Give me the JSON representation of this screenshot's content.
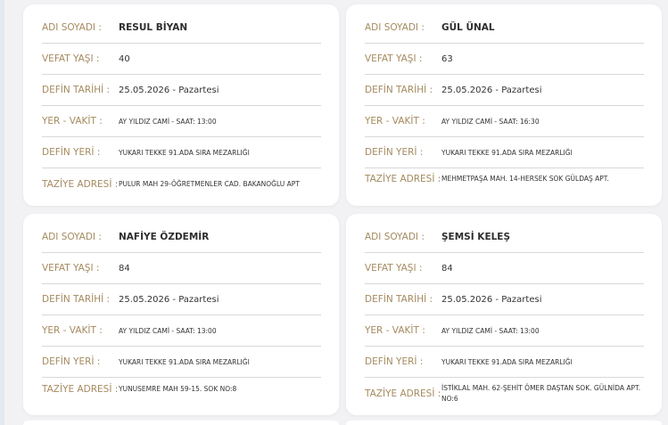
{
  "labels": {
    "name": "ADI SOYADI :",
    "age": "VEFAT YAŞI :",
    "burial_date": "DEFİN TARİHİ :",
    "place_time": "YER - VAKİT :",
    "burial_place": "DEFİN YERİ :",
    "condolence_address": "TAZİYE ADRESİ :"
  },
  "cards": [
    {
      "name": "RESUL BİYAN",
      "age": "40",
      "burial_date": "25.05.2026 - Pazartesi",
      "place_time": "AY YILDIZ CAMİ - SAAT: 13:00",
      "burial_place": "YUKARI TEKKE 91.ADA SIRA MEZARLIĞI",
      "condolence_address": "PULUR MAH 29-ÖĞRETMENLER CAD. BAKANOĞLU APT"
    },
    {
      "name": "GÜL ÜNAL",
      "age": "63",
      "burial_date": "25.05.2026 - Pazartesi",
      "place_time": "AY YILDIZ CAMİ - SAAT: 16:30",
      "burial_place": "YUKARI TEKKE 91.ADA SIRA MEZARLIĞI",
      "condolence_address": "MEHMETPAŞA MAH. 14-HERSEK SOK GÜLDAŞ APT."
    },
    {
      "name": "NAFİYE ÖZDEMİR",
      "age": "84",
      "burial_date": "25.05.2026 - Pazartesi",
      "place_time": "AY YILDIZ CAMİ - SAAT: 13:00",
      "burial_place": "YUKARI TEKKE 91.ADA SIRA MEZARLIĞI",
      "condolence_address": "YUNUSEMRE MAH 59-15. SOK NO:8"
    },
    {
      "name": "ŞEMSİ KELEŞ",
      "age": "84",
      "burial_date": "25.05.2026 - Pazartesi",
      "place_time": "AY YILDIZ CAMİ - SAAT: 13:00",
      "burial_place": "YUKARI TEKKE 91.ADA SIRA MEZARLIĞI",
      "condolence_address": "İSTİKLAL MAH. 62-ŞEHİT ÖMER DAŞTAN SOK. GÜLNİDA APT. NO:6"
    }
  ]
}
